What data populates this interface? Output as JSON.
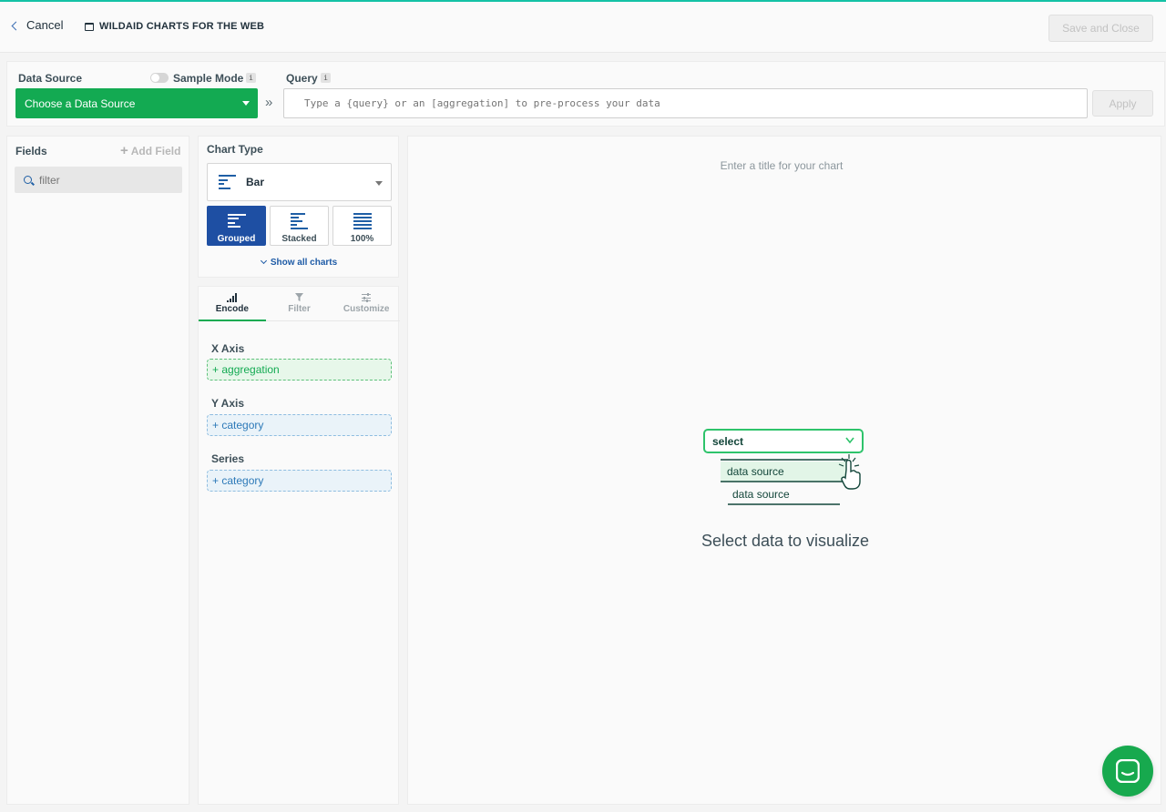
{
  "header": {
    "cancel_label": "Cancel",
    "dashboard_title": "WILDAID CHARTS FOR THE WEB",
    "save_close_label": "Save and Close"
  },
  "data_source": {
    "label": "Data Source",
    "sample_mode_label": "Sample Mode",
    "sample_mode_on": false,
    "info_badge": "i",
    "select_value": "Choose a Data Source",
    "chevrons": "»",
    "query_label": "Query",
    "query_placeholder": "Type a {query} or an [aggregation] to pre-process your data",
    "apply_label": "Apply"
  },
  "fields": {
    "title": "Fields",
    "add_field_label": "Add Field",
    "filter_placeholder": "filter"
  },
  "chart_type": {
    "title": "Chart Type",
    "selected": "Bar",
    "variants": [
      {
        "label": "Grouped",
        "active": true
      },
      {
        "label": "Stacked",
        "active": false
      },
      {
        "label": "100%",
        "active": false
      }
    ],
    "show_all_label": "Show all charts"
  },
  "encode": {
    "tabs": [
      {
        "label": "Encode",
        "icon": "bar-signal-icon",
        "active": true
      },
      {
        "label": "Filter",
        "icon": "funnel-icon",
        "active": false
      },
      {
        "label": "Customize",
        "icon": "sliders-icon",
        "active": false
      }
    ],
    "x_axis": {
      "label": "X Axis",
      "placeholder": "+ aggregation"
    },
    "y_axis": {
      "label": "Y Axis",
      "placeholder": "+ category"
    },
    "series": {
      "label": "Series",
      "placeholder": "+ category"
    }
  },
  "main": {
    "title_placeholder": "Enter a title for your chart",
    "illustration": {
      "select_text": "select",
      "option_1": "data source",
      "option_2": "data source"
    },
    "empty_message": "Select data to visualize"
  },
  "colors": {
    "accent_green": "#13aa52",
    "active_blue": "#1e4fa3",
    "link_blue": "#1e5ba6",
    "top_border_teal": "#13c2a6"
  }
}
